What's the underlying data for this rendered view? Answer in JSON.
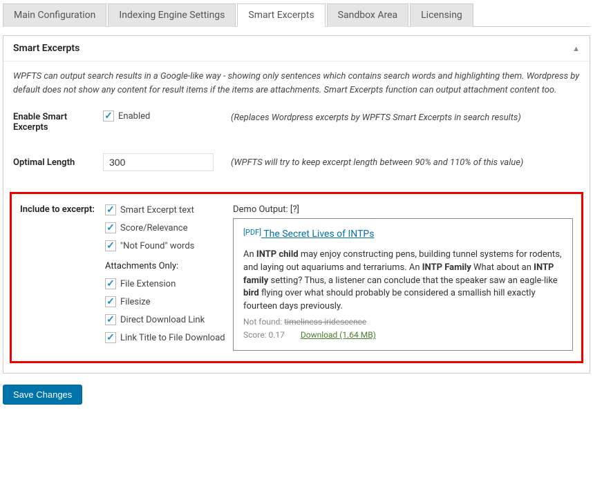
{
  "tabs": {
    "t0": "Main Configuration",
    "t1": "Indexing Engine Settings",
    "t2": "Smart Excerpts",
    "t3": "Sandbox Area",
    "t4": "Licensing"
  },
  "panel": {
    "title": "Smart Excerpts",
    "intro": "WPFTS can output search results in a Google-like way - showing only sentences which contains search words and highlighting them. Wordpress by default does not show any content for result items if the items are attachments. Smart Excerpts function can output attachment content too."
  },
  "enable": {
    "label": "Enable Smart Excerpts",
    "checkbox": "Enabled",
    "hint": "(Replaces Wordpress excerpts by WPFTS Smart Excerpts in search results)"
  },
  "length": {
    "label": "Optimal Length",
    "value": "300",
    "hint": "(WPFTS will try to keep excerpt length between 90% and 110% of this value)"
  },
  "include": {
    "label": "Include to excerpt:",
    "c1": "Smart Excerpt text",
    "c2": "Score/Relevance",
    "c3": "\"Not Found\" words",
    "subhead": "Attachments Only:",
    "c4": "File Extension",
    "c5": "Filesize",
    "c6": "Direct Download Link",
    "c7": "Link Title to File Download"
  },
  "demo": {
    "header": "Demo Output: [?]",
    "pdf_tag": "[PDF]",
    "title": " The Secret Lives of INTPs",
    "t_pre": "An ",
    "t_b1": "INTP child",
    "t_mid1": " may enjoy constructing pens, building tunnel systems for rodents, and laying out aquariums and terrariums. An ",
    "t_b2": "INTP Family",
    "t_mid2": " What about an ",
    "t_b3": "INTP family",
    "t_mid3": " setting? Thus, a listener can conclude that the speaker saw an eagle-like ",
    "t_b4": "bird",
    "t_mid4": " flying over what should probably be considered a smallish hill exactly fourteen days previously.",
    "nf_label": "Not found: ",
    "nf_words": "timeliness iridescence",
    "score": "Score: 0.17",
    "download": "Download (1.64 MB)"
  },
  "save": "Save Changes"
}
